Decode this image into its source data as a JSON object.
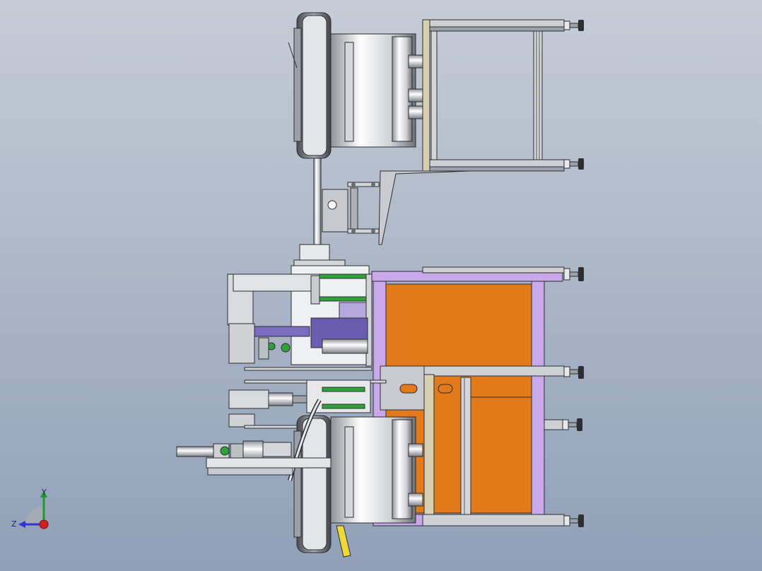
{
  "viewport": {
    "background_top": "#c6ccd6",
    "background_bottom": "#8fa0b8"
  },
  "triad": {
    "y_label": "Y",
    "z_label": "Z",
    "y_color": "#1f9a2a",
    "z_color": "#2a36d6",
    "x_color": "#d21f1f"
  },
  "colors": {
    "frame_purple": "#c8a8e8",
    "panel_orange": "#e27a1c",
    "steel_light": "#f0f0f2",
    "steel_mid": "#b9bcc2",
    "steel_dark": "#5e6168",
    "accent_green": "#2fa33a",
    "accent_yellow": "#f0d838",
    "outline": "#2c2e33"
  }
}
